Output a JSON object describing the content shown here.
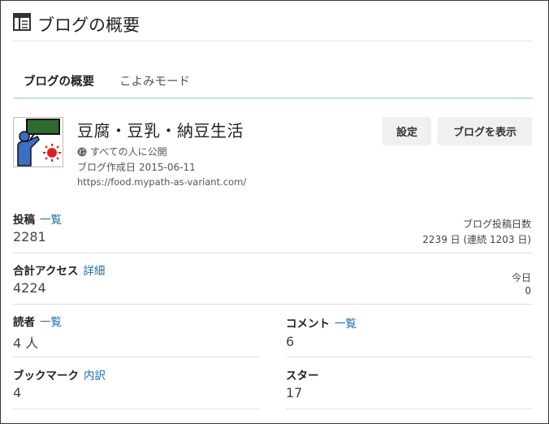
{
  "header": {
    "title": "ブログの概要"
  },
  "tabs": [
    {
      "label": "ブログの概要",
      "active": true
    },
    {
      "label": "こよみモード",
      "active": false
    }
  ],
  "blog": {
    "title": "豆腐・豆乳・納豆生活",
    "visibility": "すべての人に公開",
    "created_label": "ブログ作成日",
    "created_date": "2015-06-11",
    "url": "https://food.mypath-as-variant.com/"
  },
  "buttons": {
    "settings": "設定",
    "view_blog": "ブログを表示"
  },
  "stats": {
    "posts": {
      "label": "投稿",
      "link": "一覧",
      "value": "2281"
    },
    "posting_days": {
      "label": "ブログ投稿日数",
      "value": "2239 日 (連続 1203 日)"
    },
    "access": {
      "label": "合計アクセス",
      "link": "詳細",
      "value": "4224"
    },
    "today": {
      "label": "今日",
      "value": "0"
    },
    "readers": {
      "label": "読者",
      "link": "一覧",
      "value": "4 人"
    },
    "comments": {
      "label": "コメント",
      "link": "一覧",
      "value": "6"
    },
    "bookmarks": {
      "label": "ブックマーク",
      "link": "内訳",
      "value": "4"
    },
    "stars": {
      "label": "スター",
      "value": "17"
    }
  },
  "colors": {
    "link": "#1f6fa8",
    "tab_underline": "#c9dbe6",
    "button_bg": "#f0f0f0"
  }
}
